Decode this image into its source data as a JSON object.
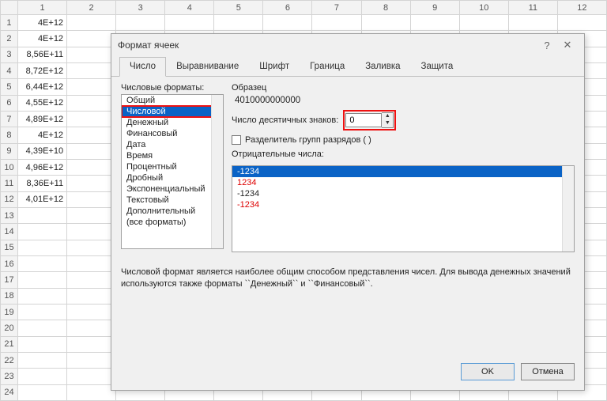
{
  "sheet": {
    "col_headers": [
      "1",
      "2",
      "3",
      "4",
      "5",
      "6",
      "7",
      "8",
      "9",
      "10",
      "11",
      "12"
    ],
    "row_headers": [
      "1",
      "2",
      "3",
      "4",
      "5",
      "6",
      "7",
      "8",
      "9",
      "10",
      "11",
      "12",
      "13",
      "14",
      "15",
      "16",
      "17",
      "18",
      "19",
      "20",
      "21",
      "22",
      "23",
      "24"
    ],
    "col1_values": [
      "4E+12",
      "4E+12",
      "8,56E+11",
      "8,72E+12",
      "6,44E+12",
      "4,55E+12",
      "4,89E+12",
      "4E+12",
      "4,39E+10",
      "4,96E+12",
      "8,36E+11",
      "4,01E+12"
    ]
  },
  "dialog": {
    "title": "Формат ячеек",
    "help_icon": "?",
    "close_icon": "✕",
    "tabs": [
      "Число",
      "Выравнивание",
      "Шрифт",
      "Граница",
      "Заливка",
      "Защита"
    ],
    "active_tab": 0,
    "formats_label": "Числовые форматы:",
    "formats": [
      "Общий",
      "Числовой",
      "Денежный",
      "Финансовый",
      "Дата",
      "Время",
      "Процентный",
      "Дробный",
      "Экспоненциальный",
      "Текстовый",
      "Дополнительный",
      "(все форматы)"
    ],
    "selected_format_index": 1,
    "sample_label": "Образец",
    "sample_value": "4010000000000",
    "decimals_label": "Число десятичных знаков:",
    "decimals_value": "0",
    "thousands_label": "Разделитель групп разрядов ( )",
    "negatives_label": "Отрицательные числа:",
    "negatives": [
      {
        "text": "-1234",
        "red": false,
        "sel": true
      },
      {
        "text": "1234",
        "red": true,
        "sel": false
      },
      {
        "text": "-1234",
        "red": false,
        "sel": false
      },
      {
        "text": "-1234",
        "red": true,
        "sel": false
      }
    ],
    "description": "Числовой формат является наиболее общим способом представления чисел. Для вывода денежных значений используются также форматы ``Денежный`` и ``Финансовый``.",
    "ok": "OK",
    "cancel": "Отмена"
  }
}
